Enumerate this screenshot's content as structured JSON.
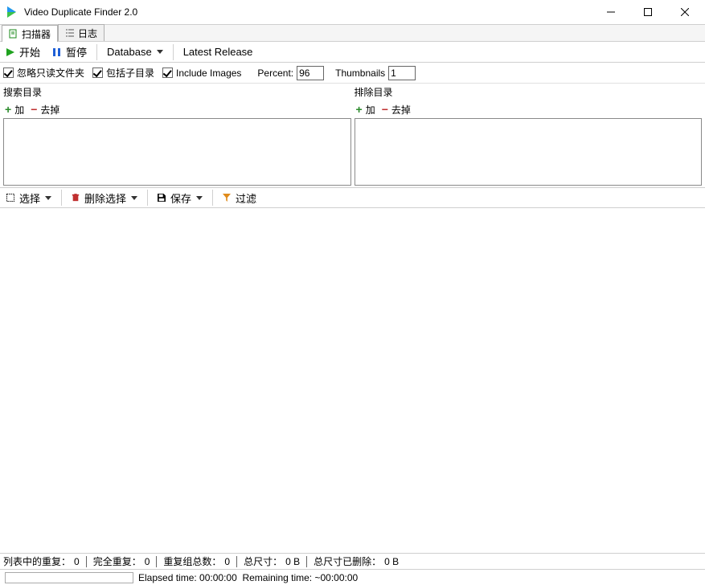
{
  "titlebar": {
    "title": "Video Duplicate Finder 2.0"
  },
  "tabs": {
    "scanner_label": "扫描器",
    "log_label": "日志"
  },
  "toolbar": {
    "start_label": "开始",
    "pause_label": "暂停",
    "database_label": "Database",
    "latest_release_label": "Latest Release"
  },
  "options": {
    "ignore_readonly_label": "忽略只读文件夹",
    "include_subdirs_label": "包括子目录",
    "include_images_label": "Include Images",
    "percent_label": "Percent:",
    "percent_value": "96",
    "thumbnails_label": "Thumbnails",
    "thumbnails_value": "1"
  },
  "dirs": {
    "search_label": "搜索目录",
    "exclude_label": "排除目录",
    "add_label": "加",
    "remove_label": "去掉"
  },
  "midbar": {
    "select_label": "选择",
    "delete_sel_label": "删除选择",
    "save_label": "保存",
    "filter_label": "过滤"
  },
  "status": {
    "dup_in_list_label": "列表中的重复：",
    "dup_in_list_value": "0",
    "complete_dup_label": "完全重复：",
    "complete_dup_value": "0",
    "dup_groups_label": "重复组总数：",
    "dup_groups_value": "0",
    "total_size_label": "总尺寸：",
    "total_size_value": "0 B",
    "deleted_size_label": "总尺寸已删除：",
    "deleted_size_value": "0 B",
    "elapsed_label": "Elapsed time:",
    "elapsed_value": "00:00:00",
    "remaining_label": "Remaining time:",
    "remaining_value": "~00:00:00"
  },
  "colors": {
    "play_green": "#1fa21f",
    "pause_blue": "#1e5fd6",
    "trash_red": "#c03030",
    "filter_orange": "#e08b1a"
  }
}
